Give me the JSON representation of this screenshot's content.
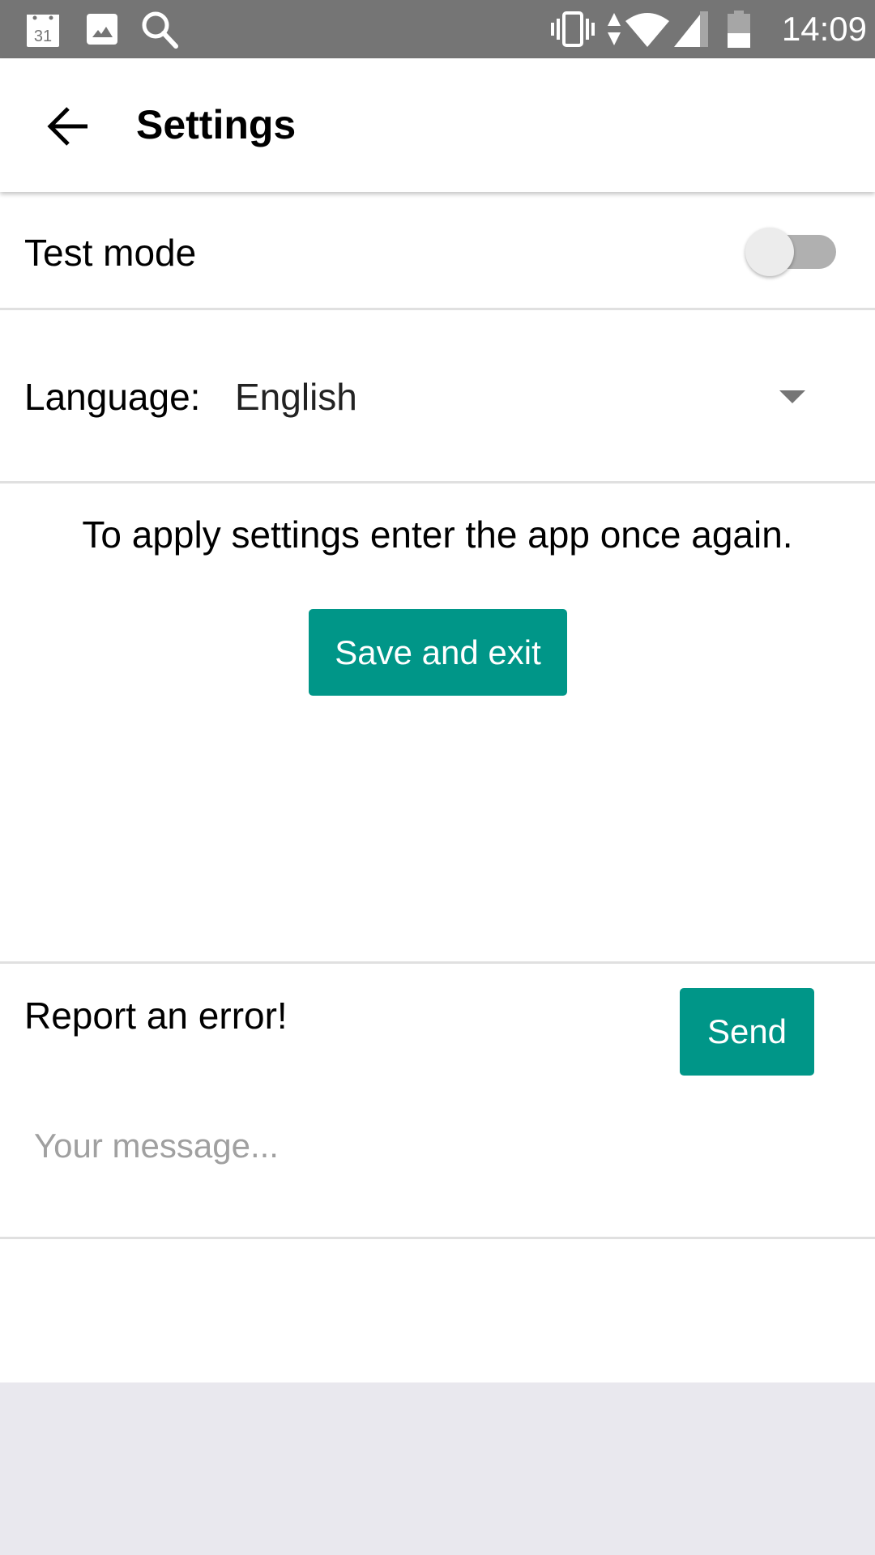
{
  "status_bar": {
    "left_icons": [
      "calendar-icon",
      "gallery-icon",
      "search-icon"
    ],
    "calendar_day": "31",
    "right_icons": [
      "vibrate-icon",
      "data-transfer-icon",
      "wifi-icon",
      "cell-signal-icon",
      "battery-icon"
    ],
    "time": "14:09"
  },
  "app_bar": {
    "back_icon": "arrow-left-icon",
    "title": "Settings"
  },
  "settings": {
    "test_mode": {
      "label": "Test mode",
      "enabled": false
    },
    "language": {
      "label": "Language:",
      "selected": "English"
    },
    "notice": "To apply settings enter the app once again.",
    "save_button": "Save and exit"
  },
  "report": {
    "title": "Report an error!",
    "send_button": "Send",
    "message_value": "",
    "message_placeholder": "Your message..."
  },
  "colors": {
    "accent": "#009688",
    "status_bar": "#757575",
    "background": "#e9e8ee",
    "divider": "#e0e0e0"
  }
}
